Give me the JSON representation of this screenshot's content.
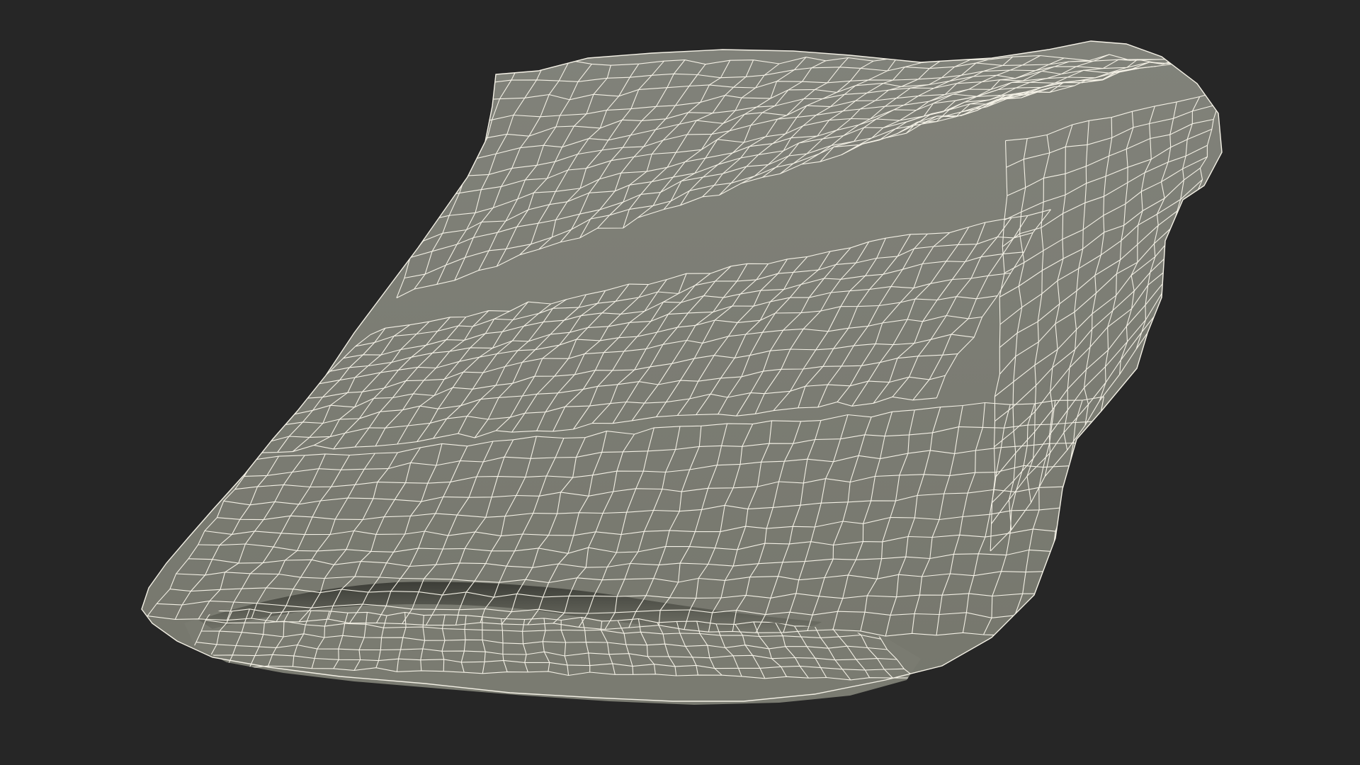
{
  "scene": {
    "background_color": "#262626",
    "mesh_fill_color": "#797a6f",
    "mesh_shadow_color": "#4a4b44",
    "wireframe_color": "#f4f1e6",
    "object": "wireframe-mesh-model",
    "wireframe_visible": true
  }
}
